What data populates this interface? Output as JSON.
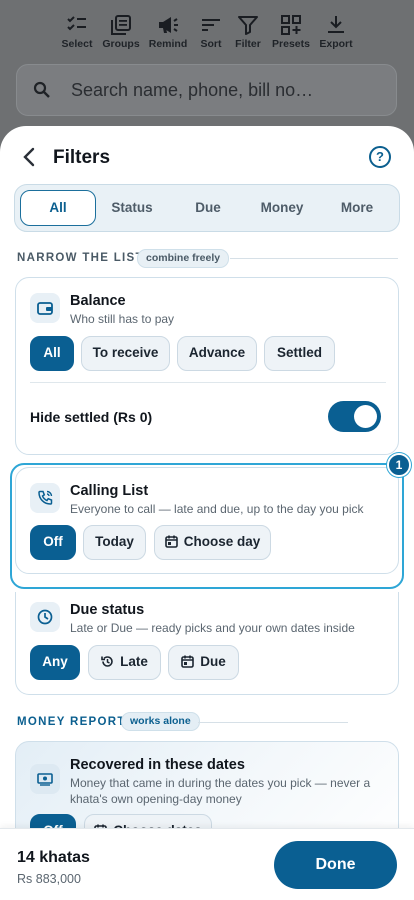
{
  "toolbar": {
    "items": [
      {
        "label": "Select",
        "icon": "checklist-icon"
      },
      {
        "label": "Groups",
        "icon": "groups-icon"
      },
      {
        "label": "Remind",
        "icon": "megaphone-icon"
      },
      {
        "label": "Sort",
        "icon": "sort-icon"
      },
      {
        "label": "Filter",
        "icon": "filter-icon"
      },
      {
        "label": "Presets",
        "icon": "presets-icon"
      },
      {
        "label": "Export",
        "icon": "export-icon"
      }
    ]
  },
  "search": {
    "placeholder": "Search name, phone, bill no…"
  },
  "sheet": {
    "title": "Filters",
    "help": "?",
    "tabs": [
      "All",
      "Status",
      "Due",
      "Money",
      "More"
    ],
    "active_tab": "All",
    "narrow": {
      "label": "NARROW THE LIST",
      "badge": "combine freely"
    },
    "balance": {
      "title": "Balance",
      "subtitle": "Who still has to pay",
      "options": [
        "All",
        "To receive",
        "Advance",
        "Settled"
      ],
      "selected": "All",
      "toggle_label": "Hide settled (Rs 0)",
      "toggle_on": true
    },
    "calling": {
      "title": "Calling List",
      "subtitle": "Everyone to call — late and due, up to the day you pick",
      "options": [
        "Off",
        "Today",
        "Choose day"
      ],
      "selected": "Off",
      "tour_step": "1"
    },
    "due_status": {
      "title": "Due status",
      "subtitle": "Late or Due — ready picks and your own dates inside",
      "options": [
        "Any",
        "Late",
        "Due"
      ],
      "selected": "Any"
    },
    "money_report": {
      "label": "MONEY REPORT",
      "badge": "works alone"
    },
    "recovered": {
      "title": "Recovered in these dates",
      "subtitle_line1": "Money that came in during the dates you pick — never a",
      "subtitle_line2": "khata's own opening-day money",
      "options": [
        "Off",
        "Choose dates"
      ]
    }
  },
  "footer": {
    "count": "14 khatas",
    "total": "Rs 883,000",
    "done": "Done"
  },
  "colors": {
    "accent": "#0a5f92",
    "highlight": "#2ea6d6"
  }
}
